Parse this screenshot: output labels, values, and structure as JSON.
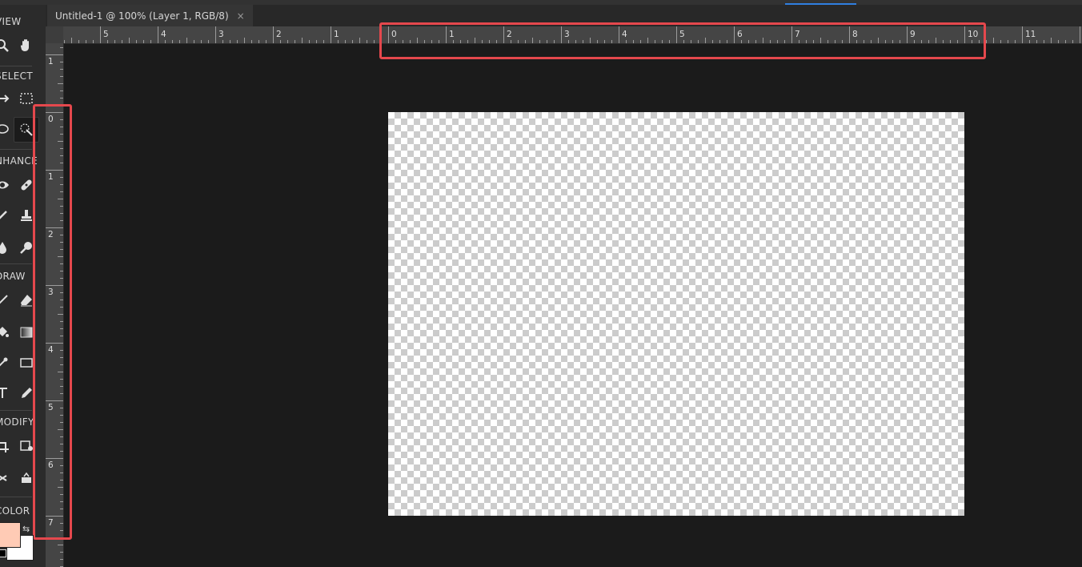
{
  "document_tab": {
    "title": "Untitled-1 @ 100% (Layer 1, RGB/8)",
    "close_glyph": "×"
  },
  "toolbar": {
    "sections": {
      "view": "VIEW",
      "select": "SELECT",
      "enhance": "NHANCE",
      "draw": "DRAW",
      "modify": "MODIFY",
      "color": "COLOR"
    },
    "tools": {
      "view": [
        "zoom-icon",
        "hand-icon"
      ],
      "select": [
        "move-icon",
        "marquee-icon",
        "lasso-icon",
        "quick-selection-icon"
      ],
      "enhance": [
        "red-eye-icon",
        "healing-brush-icon",
        "smart-brush-icon",
        "clone-stamp-icon",
        "blur-icon",
        "sponge-icon"
      ],
      "draw": [
        "brush-icon",
        "eraser-icon",
        "paint-bucket-icon",
        "gradient-icon",
        "color-picker-icon",
        "shape-icon",
        "type-icon",
        "pencil-icon"
      ],
      "modify": [
        "crop-icon",
        "recompose-icon",
        "straighten-icon",
        "content-aware-move-icon"
      ]
    },
    "colors": {
      "foreground": "#ffcbb5",
      "background": "#ffffff",
      "swap_glyph": "⇆"
    }
  },
  "rulers": {
    "horizontal_labels": [
      "5",
      "4",
      "3",
      "2",
      "1",
      "0",
      "1",
      "2",
      "3",
      "4",
      "5",
      "6",
      "7",
      "8",
      "9",
      "10",
      "11"
    ],
    "vertical_labels": [
      "1",
      "0",
      "1",
      "2",
      "3",
      "4",
      "5",
      "6",
      "7"
    ]
  },
  "highlight_color": "#e5484d"
}
